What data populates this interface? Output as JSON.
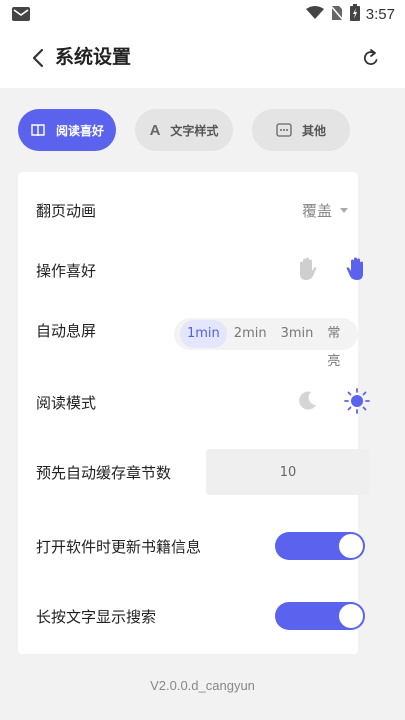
{
  "status_bar": {
    "time": "3:57",
    "icons": [
      "gmail-icon",
      "wifi-icon",
      "no-sim-icon",
      "battery-charging-icon"
    ]
  },
  "header": {
    "title": "系统设置",
    "back_icon": "chevron-left-icon",
    "reset_icon": "refresh-icon"
  },
  "tabs": [
    {
      "label": "阅读喜好",
      "icon": "book-icon",
      "active": true
    },
    {
      "label": "文字样式",
      "icon": "letter-a-icon",
      "active": false
    },
    {
      "label": "其他",
      "icon": "ellipsis-box-icon",
      "active": false
    }
  ],
  "settings": {
    "page_animation": {
      "label": "翻页动画",
      "value": "覆盖"
    },
    "operation_pref": {
      "label": "操作喜好",
      "options": [
        "left-hand-icon",
        "right-hand-icon"
      ],
      "selected": "right-hand-icon"
    },
    "auto_screen_off": {
      "label": "自动息屏",
      "options": [
        "1min",
        "2min",
        "3min",
        "常亮"
      ],
      "selected": "1min"
    },
    "read_mode": {
      "label": "阅读模式",
      "options": [
        "moon-icon",
        "sun-icon"
      ],
      "selected": "sun-icon"
    },
    "precache": {
      "label": "预先自动缓存章节数",
      "value": "10"
    },
    "update_on_open": {
      "label": "打开软件时更新书籍信息",
      "on": true
    },
    "longpress_search": {
      "label": "长按文字显示搜索",
      "on": true
    }
  },
  "version": "V2.0.0.d_cangyun",
  "colors": {
    "accent": "#5b63ee",
    "accent_light": "#e4e6fb",
    "background": "#f2f2f2"
  }
}
